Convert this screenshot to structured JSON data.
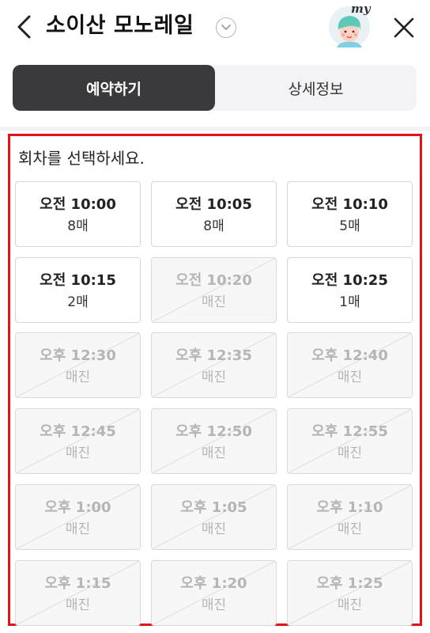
{
  "header": {
    "title": "소이산 모노레일",
    "avatar_label": "my",
    "icons": {
      "back": "chevron-left-icon",
      "dropdown": "chevron-down-icon",
      "close": "close-icon"
    }
  },
  "tabs": [
    {
      "label": "예약하기",
      "active": true
    },
    {
      "label": "상세정보",
      "active": false
    }
  ],
  "booking": {
    "prompt": "회차를 선택하세요.",
    "slots": [
      {
        "time": "오전 10:00",
        "status": "8매",
        "sold_out": false
      },
      {
        "time": "오전 10:05",
        "status": "8매",
        "sold_out": false
      },
      {
        "time": "오전 10:10",
        "status": "5매",
        "sold_out": false
      },
      {
        "time": "오전 10:15",
        "status": "2매",
        "sold_out": false
      },
      {
        "time": "오전 10:20",
        "status": "매진",
        "sold_out": true
      },
      {
        "time": "오전 10:25",
        "status": "1매",
        "sold_out": false
      },
      {
        "time": "오후 12:30",
        "status": "매진",
        "sold_out": true
      },
      {
        "time": "오후 12:35",
        "status": "매진",
        "sold_out": true
      },
      {
        "time": "오후 12:40",
        "status": "매진",
        "sold_out": true
      },
      {
        "time": "오후 12:45",
        "status": "매진",
        "sold_out": true
      },
      {
        "time": "오후 12:50",
        "status": "매진",
        "sold_out": true
      },
      {
        "time": "오후 12:55",
        "status": "매진",
        "sold_out": true
      },
      {
        "time": "오후 1:00",
        "status": "매진",
        "sold_out": true
      },
      {
        "time": "오후 1:05",
        "status": "매진",
        "sold_out": true
      },
      {
        "time": "오후 1:10",
        "status": "매진",
        "sold_out": true
      },
      {
        "time": "오후 1:15",
        "status": "매진",
        "sold_out": true
      },
      {
        "time": "오후 1:20",
        "status": "매진",
        "sold_out": true
      },
      {
        "time": "오후 1:25",
        "status": "매진",
        "sold_out": true
      }
    ]
  },
  "colors": {
    "active_tab": "#3a3a3c",
    "highlight_border": "#e0131b",
    "sold_out_text": "#b5b5b5"
  }
}
